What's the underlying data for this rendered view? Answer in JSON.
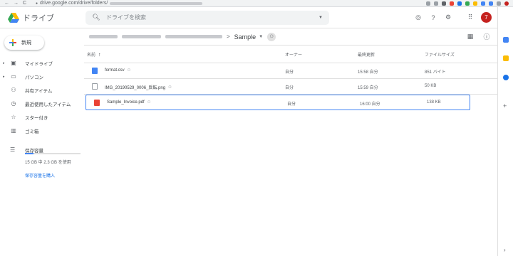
{
  "browser": {
    "url_host": "drive.google.com/drive/folders/",
    "nav_back": "←",
    "nav_forward": "→",
    "nav_reload": "C",
    "lock": "🔒"
  },
  "app": {
    "name": "ドライブ",
    "search_placeholder": "ドライブを検索",
    "avatar_letter": "7"
  },
  "sidebar": {
    "new_label": "新規",
    "items": [
      {
        "label": "マイドライブ",
        "icon": "drive-icon",
        "caret": "▸"
      },
      {
        "label": "パソコン",
        "icon": "computer-icon",
        "caret": "▸"
      },
      {
        "label": "共有アイテム",
        "icon": "shared-icon",
        "caret": ""
      },
      {
        "label": "最近使用したアイテム",
        "icon": "clock-icon",
        "caret": ""
      },
      {
        "label": "スター付き",
        "icon": "star-icon",
        "caret": ""
      },
      {
        "label": "ゴミ箱",
        "icon": "trash-icon",
        "caret": ""
      }
    ],
    "storage": {
      "label": "保存容量",
      "usage_text": "15 GB 中 2.3 GB を使用",
      "used_fraction": 0.15,
      "buy_label": "保存容量を購入"
    }
  },
  "breadcrumb": {
    "separator": ">",
    "current": "Sample"
  },
  "table": {
    "headers": {
      "name": "名前",
      "owner": "オーナー",
      "modified": "最終更新",
      "size": "ファイルサイズ"
    },
    "sort_arrow": "↑",
    "rows": [
      {
        "name": "format.csv",
        "owner": "自分",
        "modified": "15:58 自分",
        "size": "851 バイト",
        "icon": "csv-file-icon"
      },
      {
        "name": "IMG_20190529_0006_反転.png",
        "owner": "自分",
        "modified": "15:59 自分",
        "size": "50 KB",
        "icon": "image-file-icon"
      },
      {
        "name": "Sample_Invoice.pdf",
        "owner": "自分",
        "modified": "16:00 自分",
        "size": "138 KB",
        "icon": "pdf-file-icon"
      }
    ]
  },
  "colors": {
    "accent": "#4285f4",
    "selected_border": "#4285f4",
    "avatar": "#c5221f",
    "pdf": "#ea4335"
  }
}
